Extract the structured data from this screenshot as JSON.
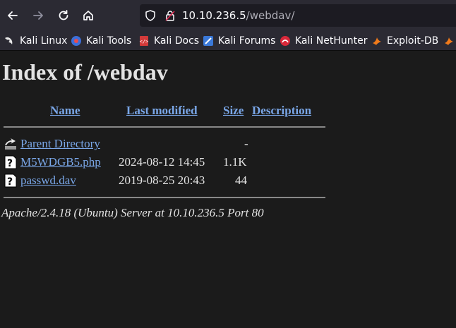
{
  "browser": {
    "url_host": "10.10.236.5",
    "url_path": "/webdav/",
    "icons": [
      "back-icon",
      "forward-icon",
      "reload-icon",
      "home-icon",
      "shield-icon",
      "lock-icon"
    ]
  },
  "bookmarks": [
    {
      "label": "Kali Linux",
      "icon": "kali-dragon-icon"
    },
    {
      "label": "Kali Tools",
      "icon": "kali-tools-icon"
    },
    {
      "label": "Kali Docs",
      "icon": "kali-docs-icon"
    },
    {
      "label": "Kali Forums",
      "icon": "kali-forums-icon"
    },
    {
      "label": "Kali NetHunter",
      "icon": "nethunter-icon"
    },
    {
      "label": "Exploit-DB",
      "icon": "exploit-db-icon"
    }
  ],
  "page": {
    "title": "Index of /webdav",
    "headers": {
      "name": "Name",
      "last_modified": "Last modified",
      "size": "Size",
      "description": "Description"
    },
    "rows": [
      {
        "name": "Parent Directory",
        "modified": "",
        "size": "-",
        "icon": "back-folder-icon"
      },
      {
        "name": "M5WDGB5.php",
        "modified": "2024-08-12 14:45",
        "size": "1.1K",
        "icon": "unknown-file-icon"
      },
      {
        "name": "passwd.dav",
        "modified": "2019-08-25 20:43",
        "size": "44",
        "icon": "unknown-file-icon"
      }
    ],
    "address": "Apache/2.4.18 (Ubuntu) Server at 10.10.236.5 Port 80"
  },
  "colors": {
    "link": "#7aa7e8",
    "page_bg": "#1b1b1b",
    "toolbar_bg": "#2b2a33"
  }
}
